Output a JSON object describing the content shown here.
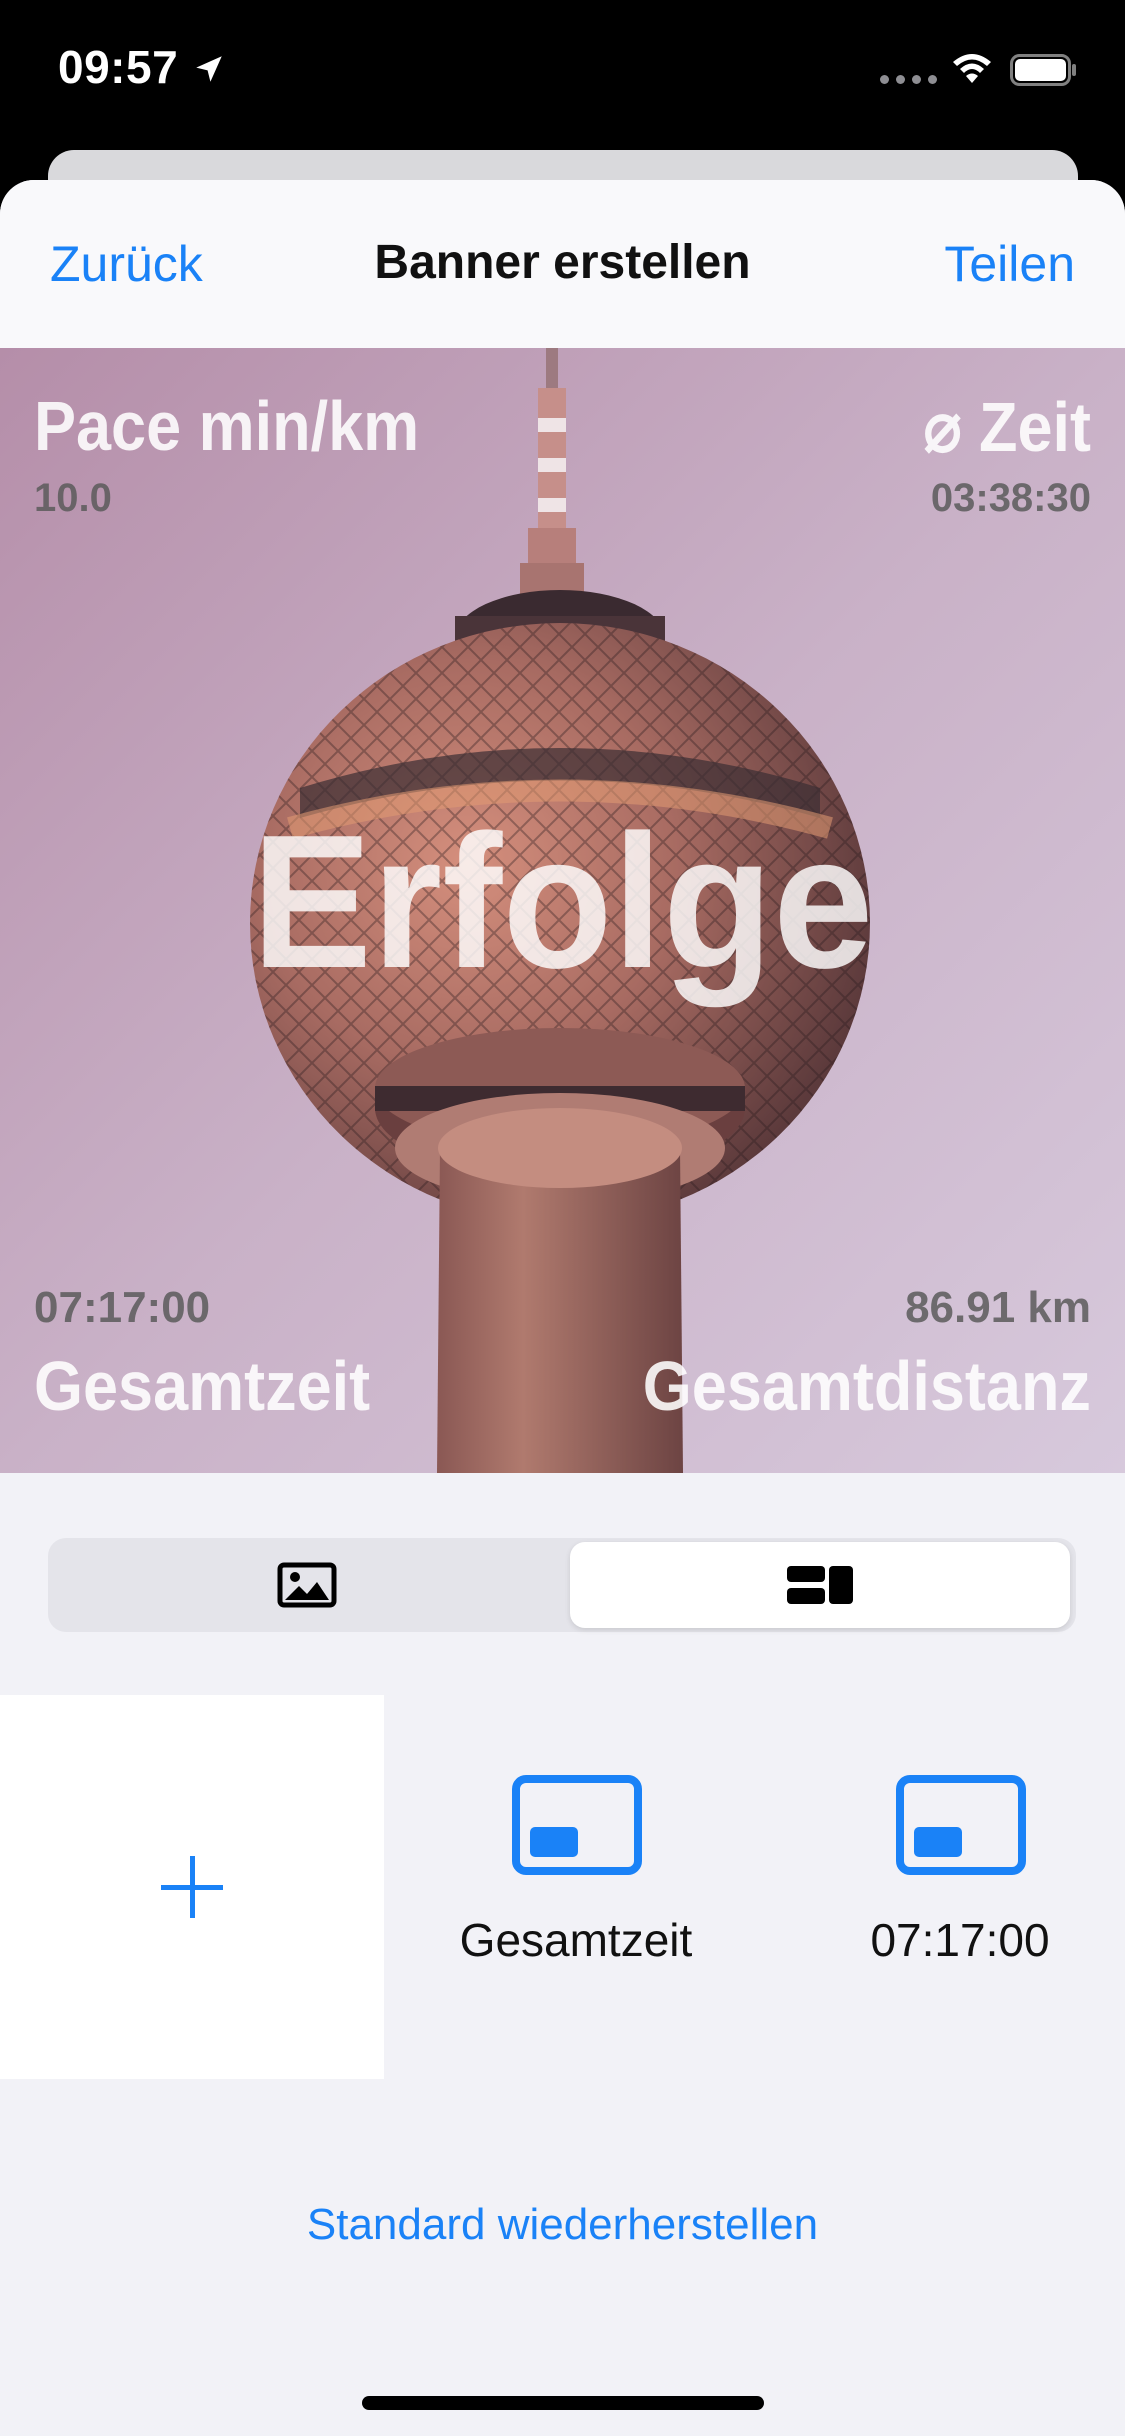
{
  "status_bar": {
    "time": "09:57",
    "icons": [
      "location-arrow-icon",
      "cellular-signal-icon",
      "wifi-icon",
      "battery-icon"
    ]
  },
  "nav": {
    "back_label": "Zurück",
    "title": "Banner erstellen",
    "share_label": "Teilen"
  },
  "banner": {
    "title": "Erfolge",
    "top_left_label": "Pace min/km",
    "top_left_value": "10.0",
    "top_right_label": "⌀ Zeit",
    "top_right_value": "03:38:30",
    "bottom_left_label": "Gesamtzeit",
    "bottom_left_value": "07:17:00",
    "bottom_right_label": "Gesamtdistanz",
    "bottom_right_value": "86.91 km",
    "background": "TV tower photo (pink tint)"
  },
  "segmented_control": {
    "options": [
      {
        "icon": "photo-icon",
        "selected": false
      },
      {
        "icon": "layout-icon",
        "selected": true
      }
    ]
  },
  "elements": {
    "add_icon": "plus-icon",
    "items": [
      {
        "label": "Gesamtzeit",
        "icon": "banner-element-icon"
      },
      {
        "label": "07:17:00",
        "icon": "banner-element-icon"
      }
    ]
  },
  "footer": {
    "restore_label": "Standard wiederherstellen"
  },
  "colors": {
    "accent": "#1A82F7",
    "background": "#F2F2F7"
  }
}
